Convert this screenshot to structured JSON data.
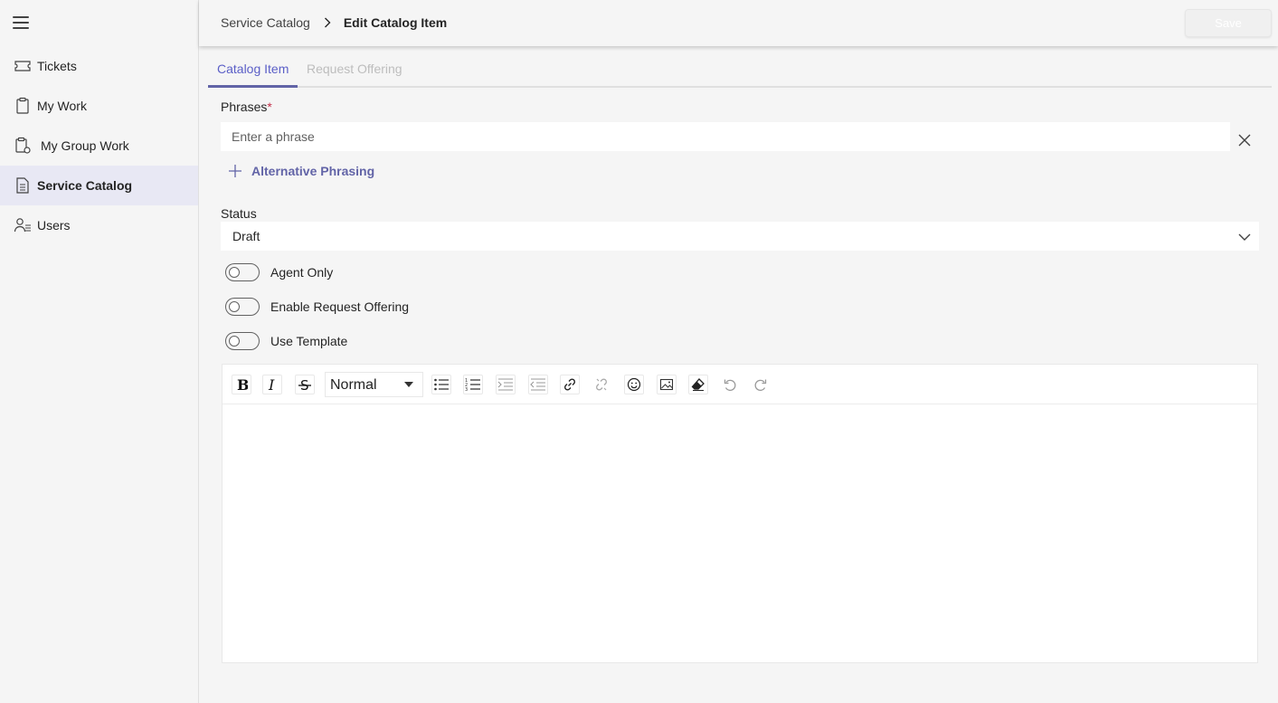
{
  "sidebar": {
    "items": [
      {
        "label": "Tickets",
        "icon": "ticket-icon"
      },
      {
        "label": "My Work",
        "icon": "clipboard-icon"
      },
      {
        "label": "My Group Work",
        "icon": "group-work-icon"
      },
      {
        "label": "Service Catalog",
        "icon": "document-icon",
        "active": true
      },
      {
        "label": "Users",
        "icon": "users-icon"
      }
    ]
  },
  "header": {
    "breadcrumb_root": "Service Catalog",
    "breadcrumb_current": "Edit Catalog Item",
    "save_label": "Save"
  },
  "tabs": [
    {
      "label": "Catalog Item",
      "active": true
    },
    {
      "label": "Request Offering",
      "disabled": true
    }
  ],
  "form": {
    "phrases_label": "Phrases",
    "required_marker": "*",
    "phrase_placeholder": "Enter a phrase",
    "alt_phrasing_label": "Alternative Phrasing",
    "status_label": "Status",
    "status_value": "Draft",
    "toggles": [
      {
        "label": "Agent Only",
        "on": false
      },
      {
        "label": "Enable Request Offering",
        "on": false
      },
      {
        "label": "Use Template",
        "on": false
      }
    ]
  },
  "editor": {
    "format_value": "Normal",
    "body_text": ""
  },
  "colors": {
    "accent": "#6264a7",
    "active_nav_bg": "#e8e8f4",
    "background": "#f5f5f5",
    "required": "#c4314b"
  }
}
